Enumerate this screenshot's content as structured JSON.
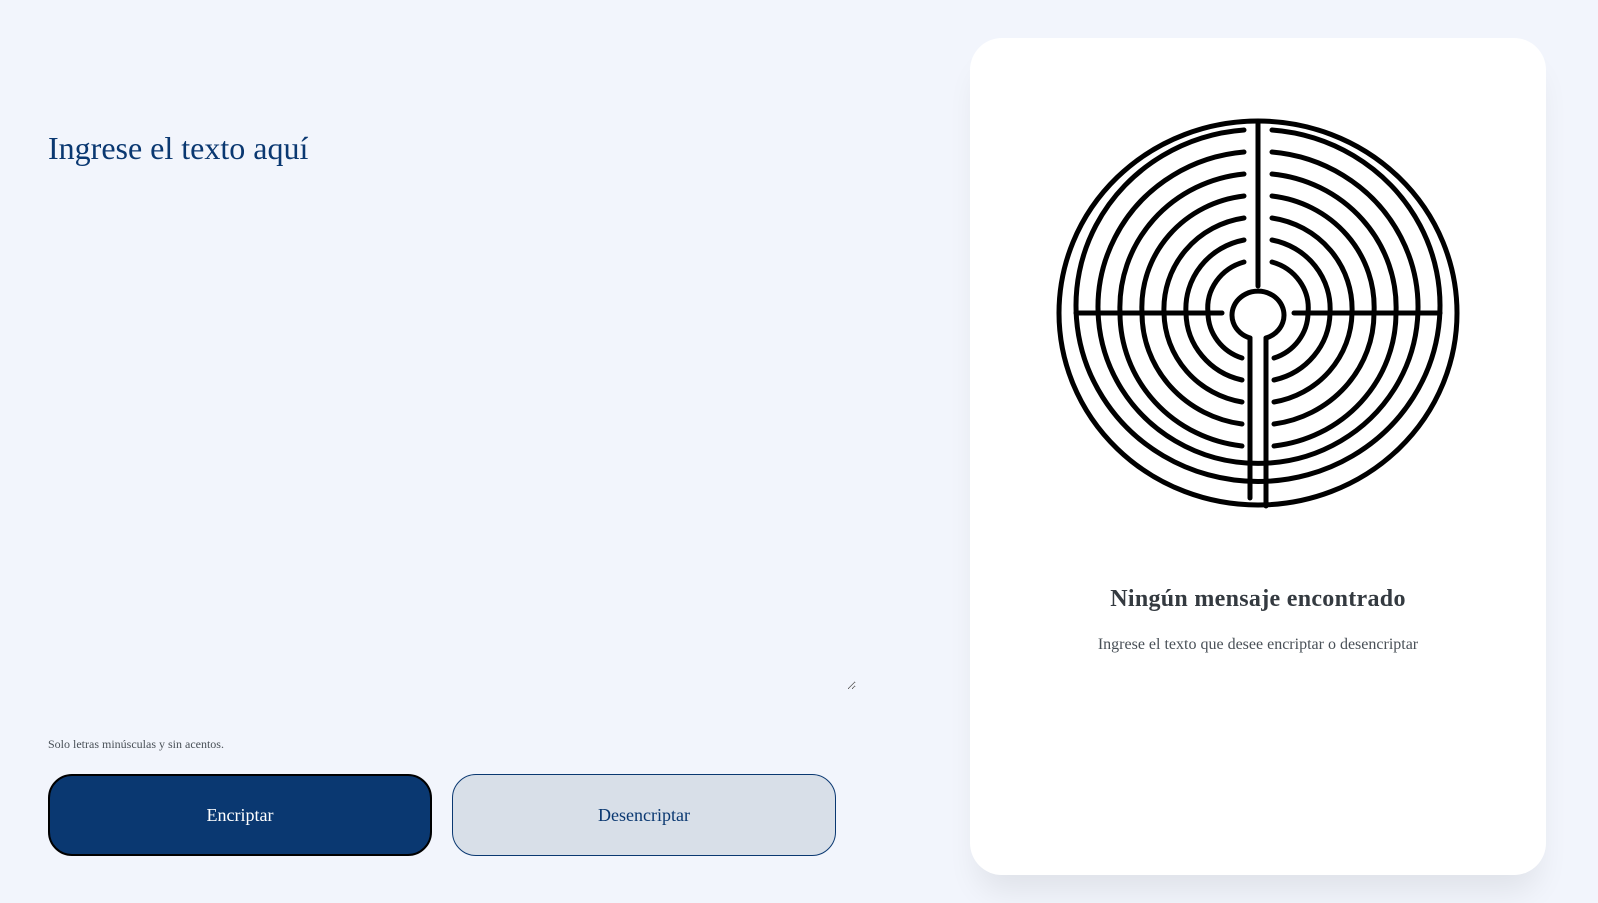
{
  "input": {
    "placeholder": "Ingrese el texto aquí",
    "value": ""
  },
  "hint": "Solo letras minúsculas y sin acentos.",
  "buttons": {
    "encrypt": "Encriptar",
    "decrypt": "Desencriptar"
  },
  "output": {
    "illustration": "labyrinth-icon",
    "title": "Ningún mensaje encontrado",
    "subtitle": "Ingrese el texto que desee encriptar o desencriptar"
  },
  "colors": {
    "background": "#f2f5fc",
    "primary": "#0a3871",
    "secondary_button": "#d8dfe8",
    "card": "#ffffff"
  }
}
